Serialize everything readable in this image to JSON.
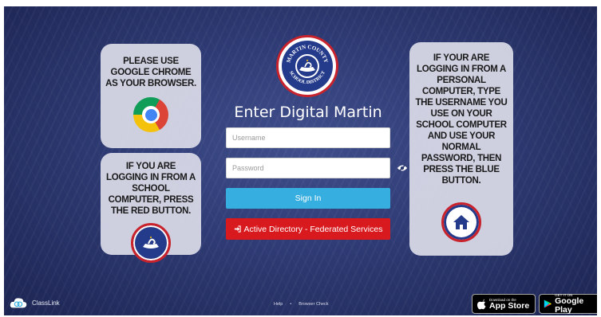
{
  "login": {
    "title": "Enter Digital Martin",
    "username_placeholder": "Username",
    "password_placeholder": "Password",
    "signin_label": "Sign In",
    "adfs_label": "Active Directory - Federated Services",
    "adfs_icon": "sign-in-icon"
  },
  "seal": {
    "top_text": "MARTIN COUNTY",
    "bottom_text": "SCHOOL DISTRICT"
  },
  "panels": {
    "chrome_note": "PLEASE USE GOOGLE CHROME AS YOUR BROWSER.",
    "school_computer_note": "IF YOU ARE LOGGING IN FROM A SCHOOL COMPUTER, PRESS THE RED BUTTON.",
    "personal_computer_note": "IF YOUR ARE LOGGING IN FROM A PERSONAL COMPUTER, TYPE THE USERNAME YOU USE ON YOUR SCHOOL COMPUTER AND USE YOUR NORMAL PASSWORD, THEN PRESS THE BLUE BUTTON."
  },
  "footer": {
    "classlink_label": "ClassLink",
    "help": "Help",
    "separator": "•",
    "browser_check": "Browser Check",
    "appstore_small": "Download on the",
    "appstore_big": "App Store",
    "googleplay_small": "GET IT ON",
    "googleplay_big": "Google Play"
  },
  "colors": {
    "background": "#2e3a73",
    "signin": "#37aee0",
    "adfs": "#d81a1f",
    "seal_blue": "#243a8a",
    "seal_red": "#c8232c"
  }
}
